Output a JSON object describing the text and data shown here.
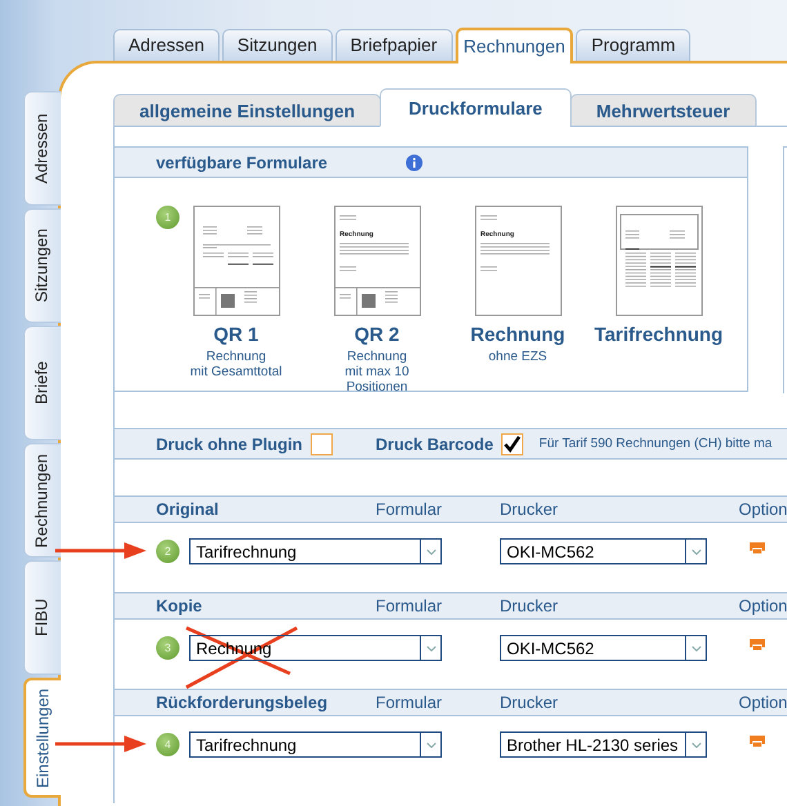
{
  "top_tabs": [
    {
      "label": "Adressen",
      "selected": false
    },
    {
      "label": "Sitzungen",
      "selected": false
    },
    {
      "label": "Briefpapier",
      "selected": false
    },
    {
      "label": "Rechnungen",
      "selected": true
    },
    {
      "label": "Programm",
      "selected": false
    }
  ],
  "side_tabs": [
    {
      "label": "Adressen",
      "selected": false
    },
    {
      "label": "Sitzungen",
      "selected": false
    },
    {
      "label": "Briefe",
      "selected": false
    },
    {
      "label": "Rechnungen",
      "selected": false
    },
    {
      "label": "FIBU",
      "selected": false
    },
    {
      "label": "Einstellungen",
      "selected": true
    }
  ],
  "sub_tabs": [
    {
      "label": "allgemeine Einstellungen",
      "selected": false
    },
    {
      "label": "Druckformulare",
      "selected": true
    },
    {
      "label": "Mehrwertsteuer",
      "selected": false
    }
  ],
  "forms_panel": {
    "title": "verfügbare Formulare",
    "badge": "1",
    "forms": [
      {
        "kind": "qr",
        "name": "QR 1",
        "description": "Rechnung\nmit Gesamttotal"
      },
      {
        "kind": "qr",
        "preview_title": "Rechnung",
        "name": "QR 2",
        "description": "Rechnung\nmit max 10\nPositionen"
      },
      {
        "kind": "plain",
        "preview_title": "Rechnung",
        "name": "Rechnung",
        "description": "ohne EZS"
      },
      {
        "kind": "tarif",
        "name": "Tarifrechnung"
      }
    ]
  },
  "print_options": {
    "items": [
      {
        "label": "Druck ohne Plugin",
        "checked": false
      },
      {
        "label": "Druck Barcode",
        "checked": true
      }
    ],
    "note": "Für Tarif 590 Rechnungen (CH) bitte ma"
  },
  "print_sections": [
    {
      "title": "Original",
      "columns": [
        "Formular",
        "Drucker",
        "Option"
      ],
      "badge": "2",
      "form": "Tarifrechnung",
      "printer": "OKI-MC562",
      "arrow": true,
      "crossed_out": false
    },
    {
      "title": "Kopie",
      "columns": [
        "Formular",
        "Drucker",
        "Option"
      ],
      "badge": "3",
      "form": "Rechnung",
      "printer": "OKI-MC562",
      "arrow": false,
      "crossed_out": true
    },
    {
      "title": "Rückforderungsbeleg",
      "columns": [
        "Formular",
        "Drucker",
        "Option"
      ],
      "badge": "4",
      "form": "Tarifrechnung",
      "printer": "Brother HL-2130 series",
      "arrow": true,
      "crossed_out": false
    }
  ]
}
